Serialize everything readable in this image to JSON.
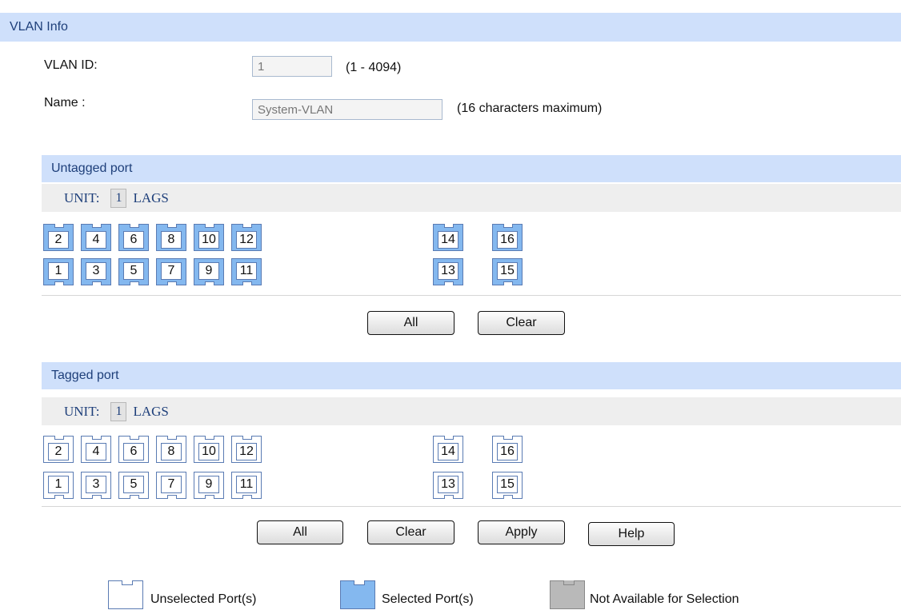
{
  "vlan_info": {
    "title": "VLAN Info",
    "vlan_id_label": "VLAN ID:",
    "vlan_id_value": "1",
    "vlan_id_hint": "(1 - 4094)",
    "name_label": "Name :",
    "name_value": "System-VLAN",
    "name_hint": "(16 characters maximum)"
  },
  "untagged": {
    "title": "Untagged port",
    "unit_label": "UNIT:",
    "unit_value": "1",
    "lags_label": "LAGS",
    "top_ports": [
      "2",
      "4",
      "6",
      "8",
      "10",
      "12"
    ],
    "bottom_ports": [
      "1",
      "3",
      "5",
      "7",
      "9",
      "11"
    ],
    "right_top_ports": [
      "14",
      "16"
    ],
    "right_bottom_ports": [
      "13",
      "15"
    ],
    "all_selected": true,
    "buttons": {
      "all": "All",
      "clear": "Clear"
    }
  },
  "tagged": {
    "title": "Tagged port",
    "unit_label": "UNIT:",
    "unit_value": "1",
    "lags_label": "LAGS",
    "top_ports": [
      "2",
      "4",
      "6",
      "8",
      "10",
      "12"
    ],
    "bottom_ports": [
      "1",
      "3",
      "5",
      "7",
      "9",
      "11"
    ],
    "right_top_ports": [
      "14",
      "16"
    ],
    "right_bottom_ports": [
      "13",
      "15"
    ],
    "all_selected": false,
    "buttons": {
      "all": "All",
      "clear": "Clear",
      "apply": "Apply",
      "help": "Help"
    }
  },
  "legend": {
    "unselected": "Unselected Port(s)",
    "selected": "Selected Port(s)",
    "not_available": "Not Available for Selection"
  },
  "colors": {
    "header_bg": "#cfe0fb",
    "selected_port": "#84b8ef",
    "unavailable_port": "#b9b9b9"
  }
}
